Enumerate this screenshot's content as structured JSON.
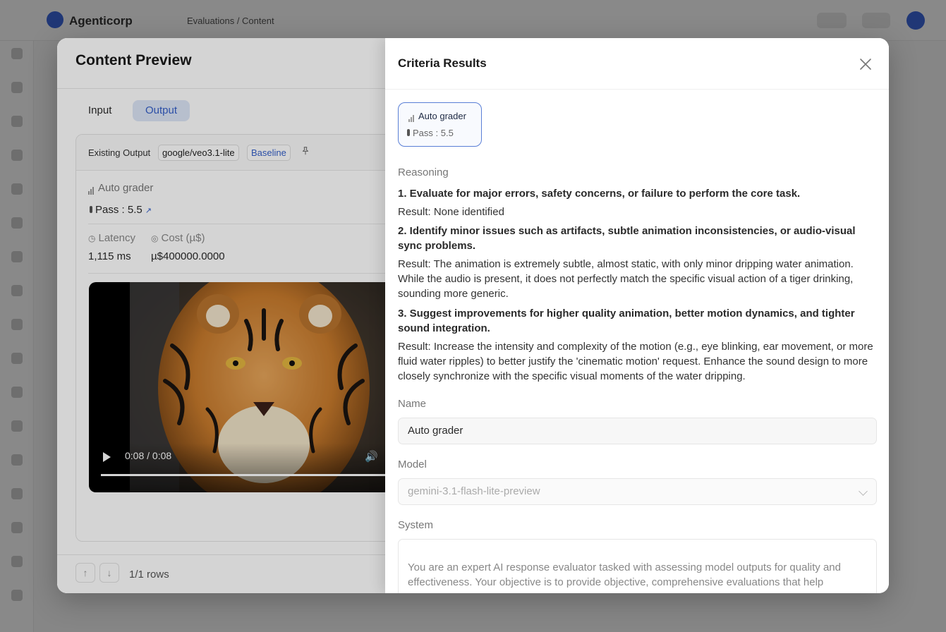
{
  "background": {
    "brand": "Agenticorp",
    "breadcrumb": "Evaluations  /  Content"
  },
  "left": {
    "title": "Content Preview",
    "tabs": [
      "Input",
      "Output"
    ],
    "active_tab": "Output",
    "existing_output_label": "Existing Output",
    "model_chip": "google/veo3.1-lite",
    "baseline_chip": "Baseline",
    "grader_name": "Auto grader",
    "pass_text": "Pass : 5.5",
    "latency_label": "Latency",
    "cost_label": "Cost (µ$)",
    "latency_value": "1,115 ms",
    "cost_value": "µ$400000.0000",
    "video_time": "0:08 / 0:08",
    "video_progress": 1.0,
    "rows_text": "1/1 rows"
  },
  "right": {
    "title": "Criteria Results",
    "grader_card": {
      "title": "Auto grader",
      "pass": "Pass : 5.5"
    },
    "reasoning_label": "Reasoning",
    "reasoning": [
      {
        "text": "1. Evaluate for major errors, safety concerns, or failure to perform the core task.",
        "bold": true
      },
      {
        "text": "Result: None identified",
        "bold": false
      },
      {
        "text": "2. Identify minor issues such as artifacts, subtle animation inconsistencies, or audio-visual sync problems.",
        "bold": true
      },
      {
        "text": "Result: The animation is extremely subtle, almost static, with only minor dripping water animation. While the audio is present, it does not perfectly match the specific visual action of a tiger drinking, sounding more generic.",
        "bold": false
      },
      {
        "text": "3. Suggest improvements for higher quality animation, better motion dynamics, and tighter sound integration.",
        "bold": true
      },
      {
        "text": "Result: Increase the intensity and complexity of the motion (e.g., eye blinking, ear movement, or more fluid water ripples) to better justify the 'cinematic motion' request. Enhance the sound design to more closely synchronize with the specific visual moments of the water dripping.",
        "bold": false
      }
    ],
    "name_label": "Name",
    "name_value": "Auto grader",
    "model_label": "Model",
    "model_value": "gemini-3.1-flash-lite-preview",
    "system_label": "System",
    "system_text": "You are an expert AI response evaluator tasked with assessing model outputs for quality and effectiveness. Your objective is to provide objective, comprehensive evaluations that help"
  },
  "colors": {
    "accent": "#3560c9",
    "active_tab_bg": "#dde6f7",
    "card_border": "#5a7fd6"
  }
}
